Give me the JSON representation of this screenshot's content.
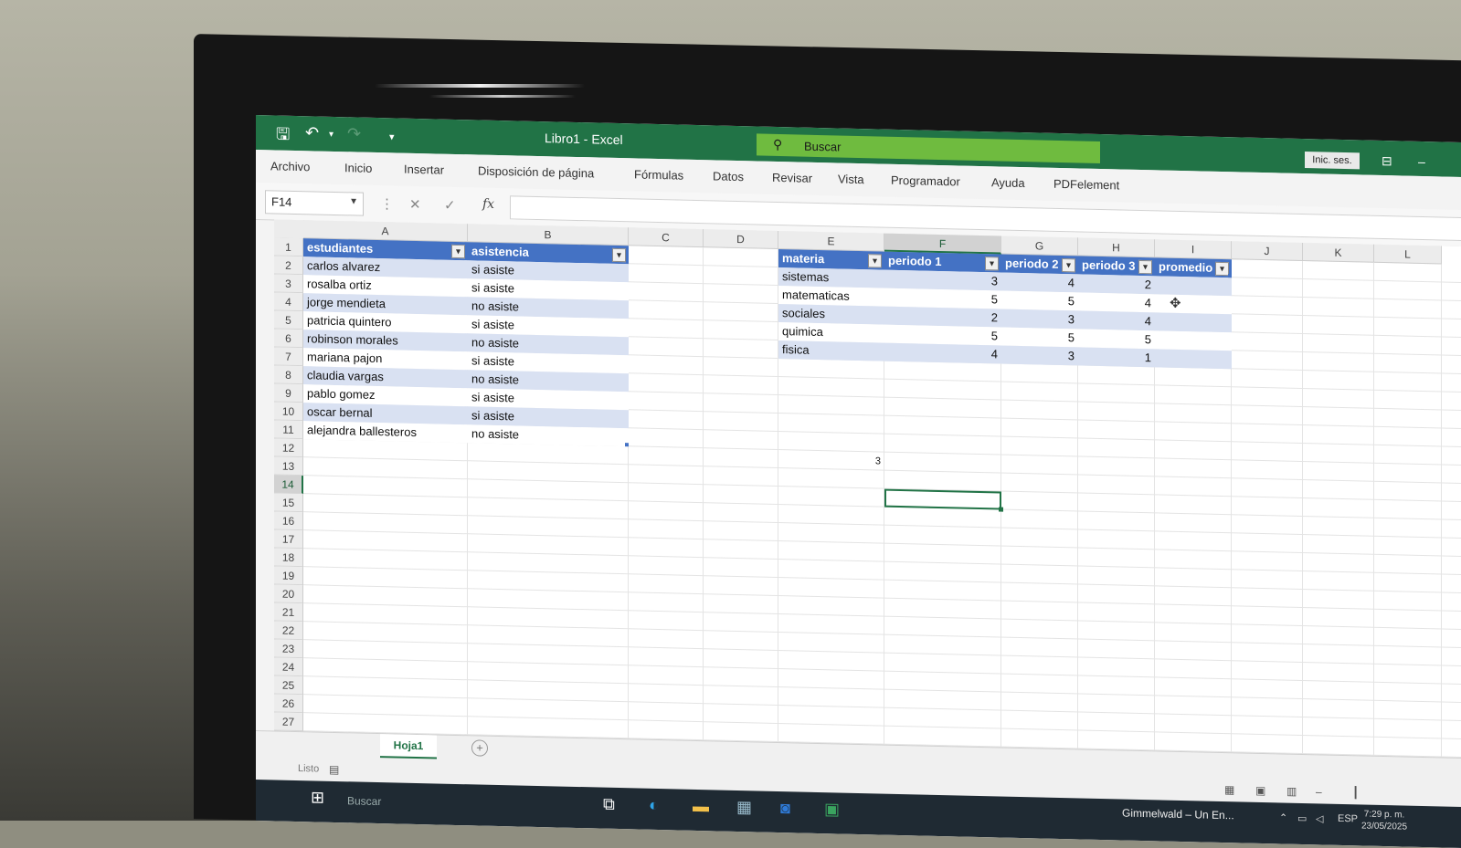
{
  "window": {
    "title": "Libro1  -  Excel",
    "search_placeholder": "Buscar",
    "signin": "Inic. ses."
  },
  "menu": [
    "Archivo",
    "Inicio",
    "Insertar",
    "Disposición de página",
    "Fórmulas",
    "Datos",
    "Revisar",
    "Vista",
    "Programador",
    "Ayuda",
    "PDFelement"
  ],
  "formula_bar": {
    "name_box": "F14",
    "cancel": "✕",
    "enter": "✓",
    "fx": "fx",
    "value": ""
  },
  "columns": [
    "A",
    "B",
    "C",
    "D",
    "E",
    "F",
    "G",
    "H",
    "I",
    "J",
    "K",
    "L"
  ],
  "rows": [
    "1",
    "2",
    "3",
    "4",
    "5",
    "6",
    "7",
    "8",
    "9",
    "10",
    "11",
    "12",
    "13",
    "14",
    "15",
    "16",
    "17",
    "18",
    "19",
    "20",
    "21",
    "22",
    "23",
    "24",
    "25",
    "26",
    "27"
  ],
  "selected_cell": {
    "column": "F",
    "row": "14"
  },
  "table1": {
    "headers": [
      "estudiantes",
      "asistencia"
    ],
    "rows": [
      [
        "carlos alvarez",
        "si asiste"
      ],
      [
        "rosalba ortiz",
        "si asiste"
      ],
      [
        "jorge mendieta",
        "no asiste"
      ],
      [
        "patricia quintero",
        "si asiste"
      ],
      [
        "robinson morales",
        "no asiste"
      ],
      [
        "mariana pajon",
        "si asiste"
      ],
      [
        "claudia vargas",
        "no asiste"
      ],
      [
        "pablo gomez",
        "si asiste"
      ],
      [
        "oscar bernal",
        "si asiste"
      ],
      [
        "alejandra ballesteros",
        "no asiste"
      ]
    ]
  },
  "table2": {
    "headers": [
      "materia",
      "periodo 1",
      "periodo 2",
      "periodo 3",
      "promedio"
    ],
    "rows": [
      [
        "sistemas",
        "3",
        "4",
        "2",
        ""
      ],
      [
        "matematicas",
        "5",
        "5",
        "4",
        ""
      ],
      [
        "sociales",
        "2",
        "3",
        "4",
        ""
      ],
      [
        "quimica",
        "5",
        "5",
        "5",
        ""
      ],
      [
        "fisica",
        "4",
        "3",
        "1",
        ""
      ]
    ]
  },
  "stray_value": "3",
  "sheets": {
    "active": "Hoja1",
    "add": "+"
  },
  "status": {
    "text": "Listo"
  },
  "taskbar": {
    "search": "Buscar",
    "media": "Gimmelwald – Un En...",
    "lang": "ESP",
    "time": "7:29 p. m.",
    "date": "23/05/2025"
  }
}
